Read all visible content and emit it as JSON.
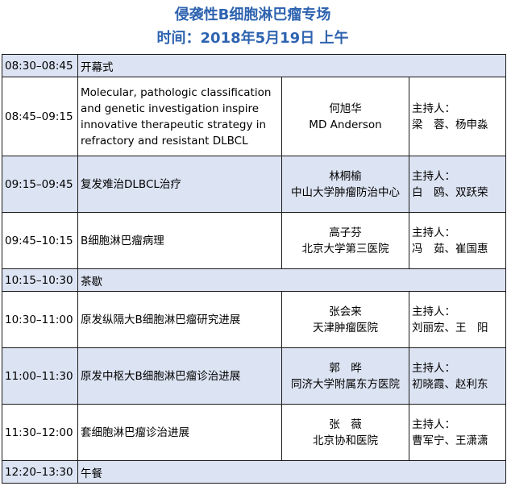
{
  "header": {
    "title": "侵袭性B细胞淋巴瘤专场",
    "subtitle": "时间：2018年5月19日 上午"
  },
  "rows": [
    {
      "time": "08:30–08:45",
      "break_label": "开幕式"
    },
    {
      "time": "08:45–09:15",
      "topic": "Molecular, pathologic classification and genetic investigation inspire innovative therapeutic strategy in refractory and resistant DLBCL",
      "speaker_name": "何旭华",
      "speaker_affil": "MD Anderson",
      "chair_label": "主持人：",
      "chairs": "梁　蓉、杨申淼"
    },
    {
      "time": "09:15–09:45",
      "topic": "复发难治DLBCL治疗",
      "speaker_name": "林桐榆",
      "speaker_affil": "中山大学肿瘤防治中心",
      "chair_label": "主持人：",
      "chairs": "白　鸥、双跃荣"
    },
    {
      "time": "09:45–10:15",
      "topic": "B细胞淋巴瘤病理",
      "speaker_name": "高子芬",
      "speaker_affil": "北京大学第三医院",
      "chair_label": "主持人：",
      "chairs": "冯　茹、崔国惠"
    },
    {
      "time": "10:15–10:30",
      "break_label": "茶歇"
    },
    {
      "time": "10:30–11:00",
      "topic": "原发纵隔大B细胞淋巴瘤研究进展",
      "speaker_name": "张会来",
      "speaker_affil": "天津肿瘤医院",
      "chair_label": "主持人：",
      "chairs": "刘丽宏、王　阳"
    },
    {
      "time": "11:00–11:30",
      "topic": "原发中枢大B细胞淋巴瘤诊治进展",
      "speaker_name": "郭　晔",
      "speaker_affil": "同济大学附属东方医院",
      "chair_label": "主持人：",
      "chairs": "初晓霞、赵利东"
    },
    {
      "time": "11:30–12:00",
      "topic": "套细胞淋巴瘤诊治进展",
      "speaker_name": "张　薇",
      "speaker_affil": "北京协和医院",
      "chair_label": "主持人：",
      "chairs": "曹军宁、王潇潇"
    },
    {
      "time": "12:20–13:30",
      "break_label": "午餐"
    }
  ]
}
